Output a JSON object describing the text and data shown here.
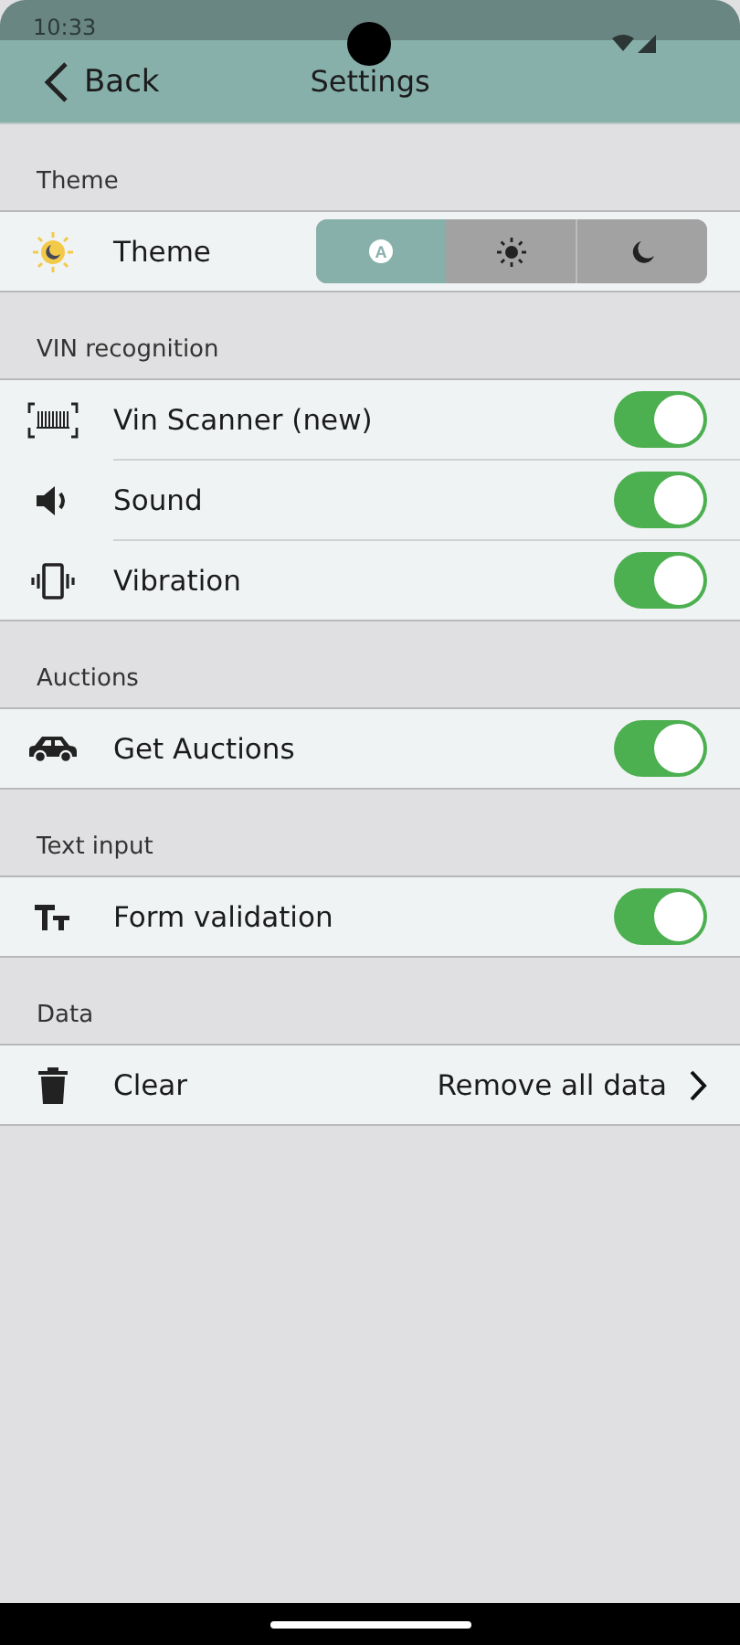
{
  "status_bar": {
    "time": "10:33"
  },
  "header": {
    "back": "Back",
    "title": "Settings"
  },
  "sections": [
    {
      "title": "Theme",
      "items": [
        {
          "kind": "segments",
          "label": "Theme",
          "segments": [
            {
              "kind": "auto",
              "text": "A",
              "selected": true
            },
            {
              "kind": "light",
              "selected": false
            },
            {
              "kind": "dark",
              "selected": false
            }
          ]
        }
      ]
    },
    {
      "title": "VIN recognition",
      "items": [
        {
          "kind": "toggle",
          "label": "Vin Scanner (new)",
          "on": true
        },
        {
          "kind": "toggle",
          "label": "Sound",
          "on": true
        },
        {
          "kind": "toggle",
          "label": "Vibration",
          "on": true
        }
      ]
    },
    {
      "title": "Auctions",
      "items": [
        {
          "kind": "toggle",
          "label": "Get Auctions",
          "on": true
        }
      ]
    },
    {
      "title": "Text input",
      "items": [
        {
          "kind": "toggle",
          "label": "Form validation",
          "on": true
        }
      ]
    },
    {
      "title": "Data",
      "items": [
        {
          "kind": "link",
          "label": "Clear",
          "value": "Remove all data"
        }
      ]
    }
  ]
}
